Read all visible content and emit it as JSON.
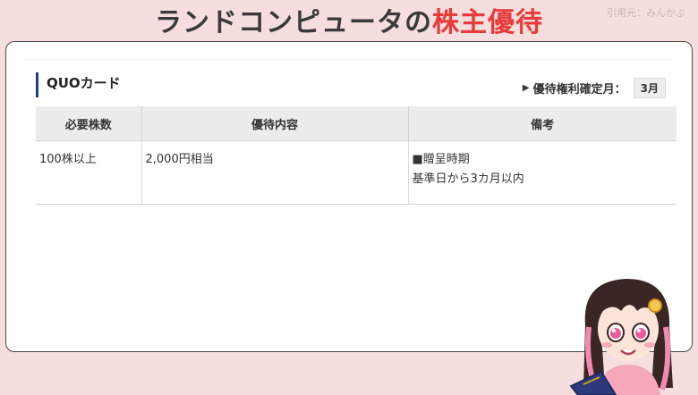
{
  "header": {
    "title_main": "ランドコンピュータの",
    "title_accent": "株主優待",
    "source": "引用元：みんかぶ"
  },
  "benefit": {
    "name": "QUOカード",
    "kakutei_label": "優待権利確定月：",
    "kakutei_month": "3月",
    "columns": [
      "必要株数",
      "優待内容",
      "備考"
    ],
    "rows": [
      {
        "shares": "100株以上",
        "content": "2,000円相当",
        "note_line1": "■贈呈時期",
        "note_line2": "基準日から3カ月以内"
      }
    ]
  },
  "colors": {
    "background": "#f6dede",
    "accent": "#e83b3b",
    "heading_bar": "#1e3f8a"
  },
  "icons": [
    "triangle-right-icon",
    "mascot-illustration"
  ]
}
